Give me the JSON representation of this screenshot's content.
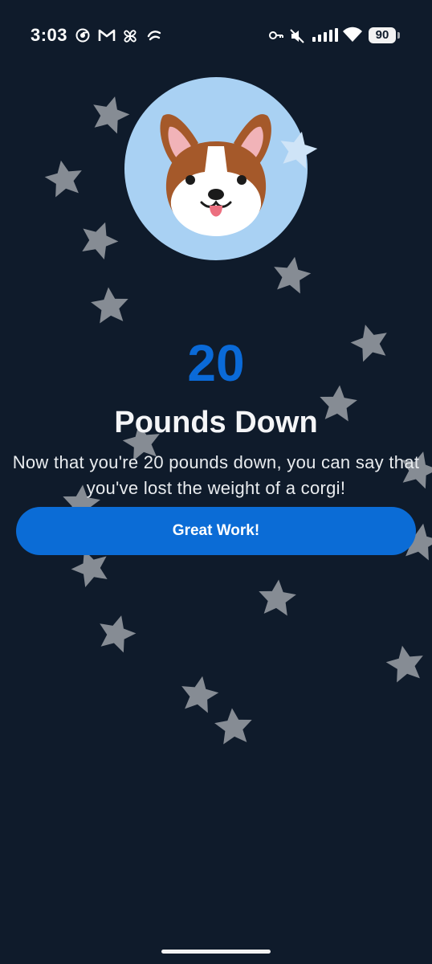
{
  "status_bar": {
    "time": "3:03",
    "battery": "90",
    "icons": [
      "chrome-icon",
      "gmail-icon",
      "pinwheel-icon",
      "app-icon",
      "key-icon",
      "mute-icon",
      "signal-icon",
      "wifi-icon"
    ]
  },
  "avatar": {
    "icon": "corgi-face-icon"
  },
  "headline": {
    "number": "20",
    "title": "Pounds Down"
  },
  "message": "Now that you're 20 pounds down, you can say that you've lost the weight of a corgi!",
  "button": {
    "label": "Great Work!"
  },
  "colors": {
    "background": "#0f1b2b",
    "accent": "#0b6cd6",
    "avatar_bg": "#a9d1f3",
    "star": "#868c94"
  }
}
